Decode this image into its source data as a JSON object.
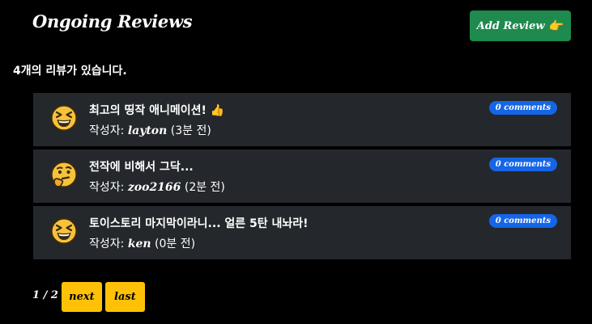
{
  "header": {
    "title": "Ongoing Reviews",
    "add_button_label": "Add Review",
    "add_button_icon": "👉"
  },
  "summary": {
    "count_text": "4개의 리뷰가 있습니다."
  },
  "reviews": [
    {
      "emoji": "laughing-face-icon",
      "title": "최고의 띵작 애니메이션!",
      "title_suffix": "👍",
      "meta_prefix": "작성자: ",
      "author": "layton",
      "meta_suffix": " (3분 전)",
      "comments": "0 comments"
    },
    {
      "emoji": "thinking-face-icon",
      "title": "전작에 비해서 그닥...",
      "title_suffix": "",
      "meta_prefix": "작성자: ",
      "author": "zoo2166",
      "meta_suffix": " (2분 전)",
      "comments": "0 comments"
    },
    {
      "emoji": "laughing-face-icon",
      "title": "토이스토리 마지막이라니... 얼른 5탄 내놔라!",
      "title_suffix": "",
      "meta_prefix": "작성자: ",
      "author": "ken",
      "meta_suffix": " (0분 전)",
      "comments": "0 comments"
    }
  ],
  "pagination": {
    "indicator": "1 / 2",
    "next_label": "next",
    "last_label": "last"
  },
  "colors": {
    "background": "#000000",
    "card": "#24272b",
    "add_button": "#1e8a4e",
    "badge": "#1565e6",
    "pager_button": "#ffc107",
    "emoji_face": "#f7c23b"
  }
}
